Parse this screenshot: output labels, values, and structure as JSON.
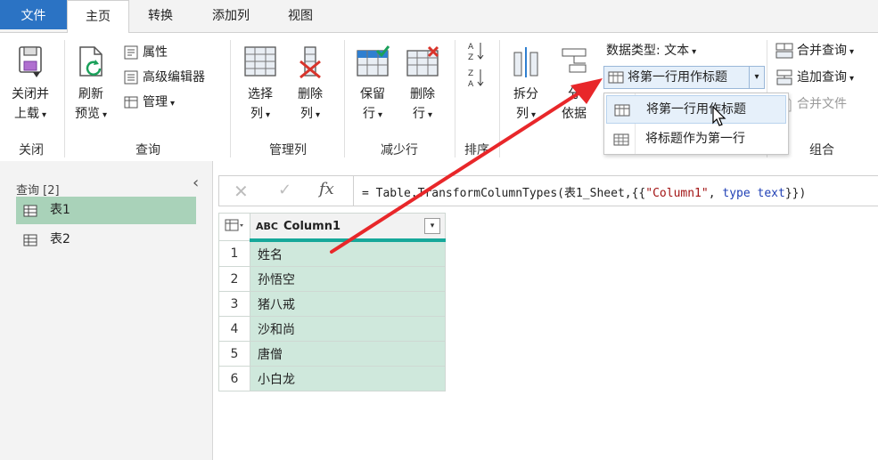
{
  "tabs": [
    "文件",
    "主页",
    "转换",
    "添加列",
    "视图"
  ],
  "ribbon": {
    "close_group": {
      "button": "关闭并上载",
      "button_l1": "关闭并",
      "button_l2": "上载",
      "label": "关闭"
    },
    "query_group": {
      "refresh_l1": "刷新",
      "refresh_l2": "预览",
      "properties": "属性",
      "advanced_editor": "高级编辑器",
      "manage": "管理",
      "label": "查询"
    },
    "manage_cols_group": {
      "choose_l1": "选择",
      "choose_l2": "列",
      "remove_l1": "删除",
      "remove_l2": "列",
      "label": "管理列"
    },
    "reduce_rows_group": {
      "keep_l1": "保留",
      "keep_l2": "行",
      "remove_l1": "删除",
      "remove_l2": "行",
      "label": "减少行"
    },
    "sort_group": {
      "label": "排序"
    },
    "transform_group": {
      "split_l1": "拆分",
      "split_l2": "列",
      "group_l1": "分",
      "group_l2": "依据",
      "data_type": "数据类型: 文本",
      "use_first_row": "将第一行用作标题"
    },
    "combine_group": {
      "merge_queries": "合并查询",
      "append_queries": "追加查询",
      "merge_files": "合并文件",
      "label": "组合"
    }
  },
  "dropdown": {
    "items": [
      "将第一行用作标题",
      "将标题作为第一行"
    ]
  },
  "queries": {
    "header": "查询 [2]",
    "items": [
      "表1",
      "表2"
    ],
    "selected": "表1"
  },
  "formula": {
    "eq": "= Table.",
    "t1": "TransformColumnTypes(表1_Sheet,{{",
    "s1": "\"Column1\"",
    "t2": ", ",
    "kw": "type text",
    "t3": "}})"
  },
  "table": {
    "column": "Column1",
    "type_icon": "ABC",
    "rows": [
      "姓名",
      "孙悟空",
      "猪八戒",
      "沙和尚",
      "唐僧",
      "小白龙"
    ],
    "row_numbers": [
      "1",
      "2",
      "3",
      "4",
      "5",
      "6"
    ]
  },
  "colors": {
    "file_tab": "#2b73c4",
    "selected_query": "#a9d2b9",
    "cell_fill": "#cfe8dc",
    "column_accent": "#16a89a",
    "arrow": "#e8272a"
  }
}
